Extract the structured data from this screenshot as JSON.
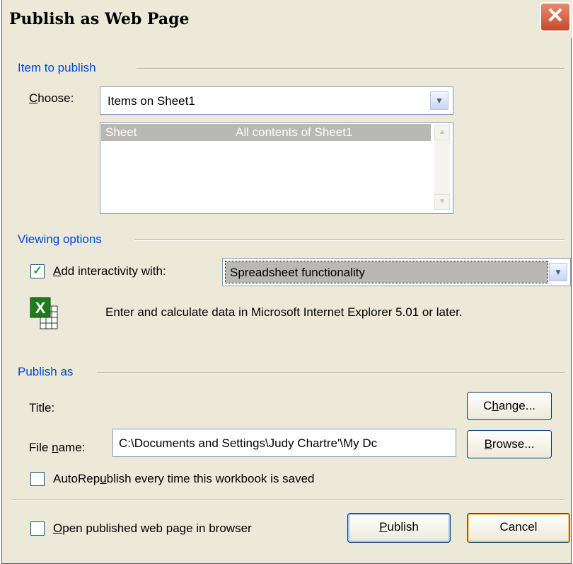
{
  "dialog": {
    "title": "Publish as Web Page",
    "close_label": "✕"
  },
  "item_section": {
    "heading": "Item to publish",
    "choose_label": "Choose:",
    "choose_access_key": "C",
    "choose_rest": "hoose:",
    "choose_value": "Items on Sheet1",
    "list": [
      {
        "item": "Sheet",
        "description": "All contents of Sheet1",
        "selected": true
      }
    ]
  },
  "viewing_section": {
    "heading": "Viewing options",
    "interactivity_checked": true,
    "interactivity_access_key": "A",
    "interactivity_rest": "dd interactivity with:",
    "interactivity_value": "Spreadsheet functionality",
    "info_text": "Enter and calculate data in Microsoft Internet Explorer 5.01 or later.",
    "info_icon": "excel-spreadsheet-icon"
  },
  "publish_section": {
    "heading": "Publish as",
    "title_label": "Title:",
    "change_button_pre": "C",
    "change_button_key": "h",
    "change_button_post": "ange...",
    "file_label_pre": "File ",
    "file_label_key": "n",
    "file_label_post": "ame:",
    "file_value": "C:\\Documents and Settings\\Judy Chartre'\\My Dc",
    "browse_button_key": "B",
    "browse_button_post": "rowse...",
    "autorepublish_pre": "AutoRep",
    "autorepublish_key": "u",
    "autorepublish_post": "blish every time this workbook is saved",
    "autorepublish_checked": false
  },
  "footer": {
    "open_browser_key": "O",
    "open_browser_post": "pen published web page in browser",
    "open_browser_checked": false,
    "publish_key": "P",
    "publish_post": "ublish",
    "cancel_label": "Cancel"
  },
  "colors": {
    "section_heading": "#0046d5",
    "dialog_bg": "#ece9d8",
    "list_selection": "#b9b8b4"
  }
}
